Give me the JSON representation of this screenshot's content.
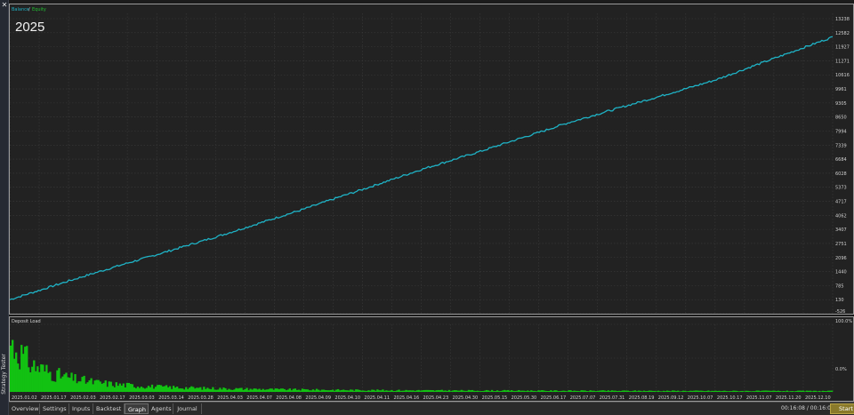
{
  "window": {
    "side_label": "Strategy Tester",
    "close_glyph": "✕"
  },
  "balance_chart": {
    "legend_balance": "Balance",
    "legend_separator": "/",
    "legend_equity": "Equity",
    "year_label": "2025"
  },
  "load_chart": {
    "title": "Deposit Load",
    "y_top": "100.0%",
    "y_bottom": "0.0%"
  },
  "tabs": [
    "Overview",
    "Settings",
    "Inputs",
    "Backtest",
    "Graph",
    "Agents",
    "Journal"
  ],
  "active_tab": "Graph",
  "status": {
    "timer": "00:16:08 / 00:16:08",
    "start_label": "Start"
  },
  "colors": {
    "balance": "#1fb3c6",
    "equity": "#22c233",
    "deposit_load": "#12c212",
    "grid": "#3b3b3b",
    "background": "#222222"
  },
  "chart_data": [
    {
      "type": "line",
      "ylabel": "",
      "yticks": [
        "13238",
        "12582",
        "11927",
        "11271",
        "10616",
        "9961",
        "9305",
        "8650",
        "7994",
        "7339",
        "6684",
        "6028",
        "5373",
        "4717",
        "4062",
        "3407",
        "2751",
        "2096",
        "1440",
        "785",
        "130",
        "-526"
      ],
      "ylim": [
        -526,
        13238
      ],
      "xticks": [
        "2025.01.02",
        "2025.01.17",
        "2025.02.03",
        "2025.02.17",
        "2025.03.03",
        "2025.03.14",
        "2025.03.28",
        "2025.04.03",
        "2025.04.07",
        "2025.04.08",
        "2025.04.09",
        "2025.04.10",
        "2025.04.11",
        "2025.04.16",
        "2025.04.23",
        "2025.04.30",
        "2025.05.15",
        "2025.05.30",
        "2025.06.17",
        "2025.07.07",
        "2025.07.31",
        "2025.08.19",
        "2025.09.12",
        "2025.10.07",
        "2025.10.17",
        "2025.11.07",
        "2025.11.20",
        "2025.12.10"
      ],
      "series": [
        {
          "name": "Balance",
          "x": [
            "2025.01.02",
            "2025.01.17",
            "2025.02.03",
            "2025.02.17",
            "2025.03.03",
            "2025.03.14",
            "2025.03.28",
            "2025.04.03",
            "2025.04.07",
            "2025.04.08",
            "2025.04.09",
            "2025.04.10",
            "2025.04.11",
            "2025.04.16",
            "2025.04.23",
            "2025.04.30",
            "2025.05.15",
            "2025.05.30",
            "2025.06.17",
            "2025.07.07",
            "2025.07.31",
            "2025.08.19",
            "2025.09.12",
            "2025.10.07",
            "2025.10.17",
            "2025.11.07",
            "2025.11.20",
            "2025.12.10",
            "2025.12.31"
          ],
          "values": [
            130,
            560,
            1000,
            1420,
            1830,
            2230,
            2640,
            3050,
            3480,
            3920,
            4350,
            4820,
            5270,
            5730,
            6200,
            6620,
            7040,
            7490,
            7930,
            8380,
            8780,
            9180,
            9570,
            9970,
            10370,
            10880,
            11380,
            11880,
            12380
          ]
        }
      ]
    },
    {
      "type": "area",
      "title": "Deposit Load",
      "ylim": [
        0,
        100
      ],
      "yticks": [
        "100.0%",
        "0.0%"
      ],
      "series": [
        {
          "name": "Deposit Load",
          "values": [
            72,
            40,
            27,
            19,
            14,
            11,
            9,
            7.5,
            6.5,
            5.5,
            5,
            4.5,
            4,
            3.6,
            3.3,
            3,
            2.8,
            2.6,
            2.4,
            2.3,
            2.2,
            2.1,
            2,
            2,
            1.9,
            1.8,
            1.8,
            1.7,
            1.7,
            1.6,
            1.6,
            1.5,
            1.5,
            1.5,
            1.4,
            1.4,
            1.4,
            1.3,
            1.3,
            1.3
          ]
        }
      ]
    }
  ]
}
